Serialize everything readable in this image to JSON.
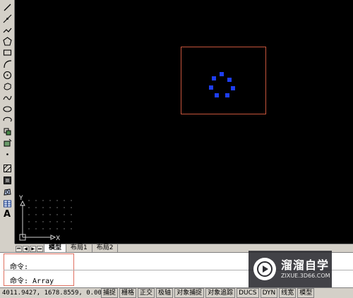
{
  "toolbar": {
    "tools": [
      {
        "name": "line-icon"
      },
      {
        "name": "construction-line-icon"
      },
      {
        "name": "polyline-icon"
      },
      {
        "name": "polygon-icon"
      },
      {
        "name": "rectangle-icon"
      },
      {
        "name": "arc-icon"
      },
      {
        "name": "circle-icon"
      },
      {
        "name": "revision-cloud-icon"
      },
      {
        "name": "spline-icon"
      },
      {
        "name": "ellipse-icon"
      },
      {
        "name": "ellipse-arc-icon"
      },
      {
        "name": "insert-block-icon"
      },
      {
        "name": "make-block-icon"
      },
      {
        "name": "point-icon"
      },
      {
        "name": "hatch-icon"
      },
      {
        "name": "gradient-icon"
      },
      {
        "name": "region-icon"
      },
      {
        "name": "table-icon"
      },
      {
        "name": "multiline-text-icon",
        "letter": "A"
      }
    ]
  },
  "canvas": {
    "ucs_x": "X",
    "ucs_y": "Y"
  },
  "tabs": {
    "nav": [
      "⏮",
      "◀",
      "▶",
      "⏭"
    ],
    "items": [
      {
        "label": "模型",
        "active": true
      },
      {
        "label": "布局1",
        "active": false
      },
      {
        "label": "布局2",
        "active": false
      }
    ]
  },
  "command": {
    "line1": "命令:",
    "line2": "命令: Array"
  },
  "watermark": {
    "title": "溜溜自学",
    "url": "ZIXUE.3D66.COM"
  },
  "status": {
    "coords": "4011.9427, 1678.8559, 0.0000",
    "buttons": [
      "捕捉",
      "栅格",
      "正交",
      "极轴",
      "对象捕捉",
      "对象追踪",
      "DUCS",
      "DYN",
      "线宽",
      "模型"
    ]
  },
  "colors": {
    "canvas_bg": "#000000",
    "grip": "#1e3ef2",
    "selection_box": "#c8553c",
    "highlight": "#e07060"
  }
}
